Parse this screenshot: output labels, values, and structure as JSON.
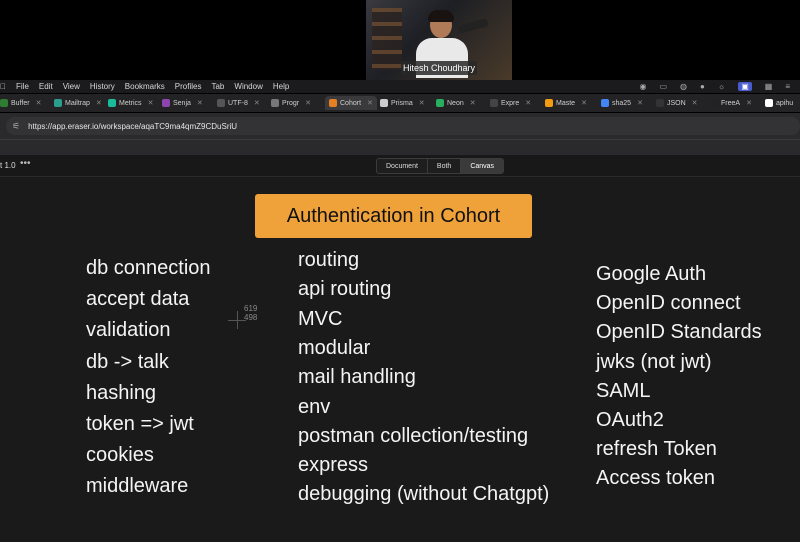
{
  "webcam": {
    "name": "Hitesh Choudhary"
  },
  "menu": {
    "apple_icon": "",
    "items": [
      "File",
      "Edit",
      "View",
      "History",
      "Bookmarks",
      "Profiles",
      "Tab",
      "Window",
      "Help"
    ]
  },
  "tabs": [
    {
      "label": "Buffer",
      "color": "#2e7d32"
    },
    {
      "label": "Mailtrap",
      "color": "#2a9d8f"
    },
    {
      "label": "Metrics",
      "color": "#1abc9c"
    },
    {
      "label": "Senja",
      "color": "#8e44ad"
    },
    {
      "label": "UTF-8",
      "color": "#555555"
    },
    {
      "label": "Progr",
      "color": "#777777"
    },
    {
      "label": "Cohort",
      "color": "#e67e22"
    },
    {
      "label": "Prisma",
      "color": "#cccccc"
    },
    {
      "label": "Neon",
      "color": "#27ae60"
    },
    {
      "label": "Expre",
      "color": "#444444"
    },
    {
      "label": "Maste",
      "color": "#f39c12"
    },
    {
      "label": "sha25",
      "color": "#4285f4"
    },
    {
      "label": "JSON",
      "color": "#333333"
    },
    {
      "label": "FreeA",
      "color": "#222222"
    },
    {
      "label": "apihu",
      "color": "#ffffff"
    }
  ],
  "address": {
    "url": "https://app.eraser.io/workspace/aqaTC9ma4qmZ9CDuSriU"
  },
  "toolbar": {
    "doc_title": "t 1.0",
    "more": "•••",
    "view_modes": [
      "Document",
      "Both",
      "Canvas"
    ],
    "active_mode": "Canvas"
  },
  "canvas": {
    "title": "Authentication in Cohort",
    "cursor_readout": [
      "619",
      "498"
    ],
    "column1": [
      "db connection",
      "accept data",
      "validation",
      "db -> talk",
      "hashing",
      "token => jwt",
      "cookies",
      "middleware"
    ],
    "column2": [
      "routing",
      "api routing",
      "MVC",
      "modular",
      "mail handling",
      "env",
      "postman collection/testing",
      "express",
      "debugging (without Chatgpt)"
    ],
    "column3": [
      "Google Auth",
      "OpenID connect",
      "OpenID Standards",
      "jwks (not jwt)",
      "SAML",
      "OAuth2",
      "refresh Token",
      "Access token"
    ]
  },
  "colors": {
    "title_box": "#f0a23a",
    "canvas_bg": "#1a1a1a",
    "text": "#f4f4f4"
  }
}
